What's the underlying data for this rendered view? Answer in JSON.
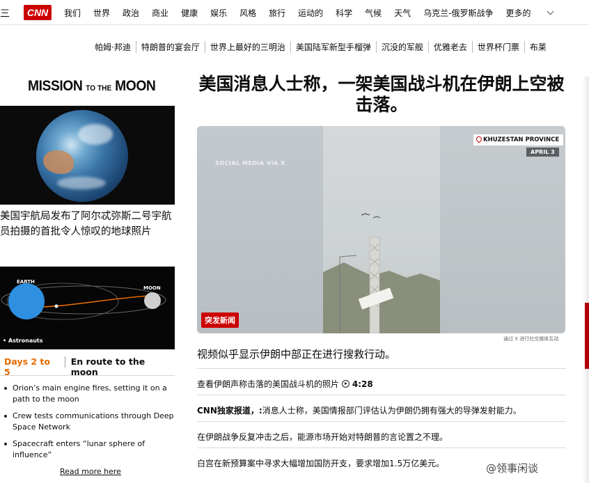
{
  "nav": {
    "menu_icon": "hamburger-icon",
    "logo": "CNN",
    "items": [
      "我们",
      "世界",
      "政治",
      "商业",
      "健康",
      "娱乐",
      "风格",
      "旅行",
      "运动的",
      "科学",
      "气候",
      "天气",
      "乌克兰-俄罗斯战争"
    ],
    "more_label": "更多的"
  },
  "subnav": [
    "帕姆·邦迪",
    "特朗普的宴会厅",
    "世界上最好的三明治",
    "美国陆军新型手榴弹",
    "沉没的军舰",
    "优雅老去",
    "世界杯门票",
    "布莱"
  ],
  "left": {
    "mission_pre": "MISSION",
    "mission_mid": "TO THE",
    "mission_post": "MOON",
    "earth_caption": "美国宇航局发布了阿尔忒弥斯二号宇航员拍摄的首批令人惊叹的地球照片",
    "trajectory": {
      "earth_label": "EARTH",
      "moon_label": "MOON",
      "astronauts_label": "• Astronauts"
    },
    "days_label": "Days 2 to 5",
    "days_title": "En route to the moon",
    "bullets": [
      "Orion’s main engine fires, setting it on a path to the moon",
      "Crew tests communications through Deep Space Network",
      "Spacecraft enters “lunar sphere of influence”"
    ],
    "read_more": "Read more here"
  },
  "main": {
    "headline": "美国消息人士称，一架美国战斗机在伊朗上空被击落。",
    "video": {
      "social_tag": "SOCIAL MEDIA VIA X",
      "location": "KHUZESTAN PROVINCE",
      "date": "APRIL 3",
      "breaking": "突发新闻",
      "credit": "通过 X 进行社交媒体互动"
    },
    "subhead": "视频似乎显示伊朗中部正在进行搜救行动。",
    "stories": [
      {
        "prefix": "",
        "text": "查看伊朗声称击落的美国战斗机的照片",
        "duration": "4:28"
      },
      {
        "prefix": "CNN独家报道，:",
        "text": "消息人士称，美国情报部门评估认为伊朗仍拥有强大的导弹发射能力。",
        "duration": ""
      },
      {
        "prefix": "",
        "text": "在伊朗战争反复冲击之后，能源市场开始对特朗普的言论置之不理。",
        "duration": ""
      },
      {
        "prefix": "",
        "text": "白宫在新预算案中寻求大幅增加国防开支，要求增加1.5万亿美元。",
        "duration": ""
      }
    ]
  },
  "watermark": "@领事闲谈",
  "colors": {
    "cnn_red": "#cc0000",
    "orange": "#e46b00"
  }
}
